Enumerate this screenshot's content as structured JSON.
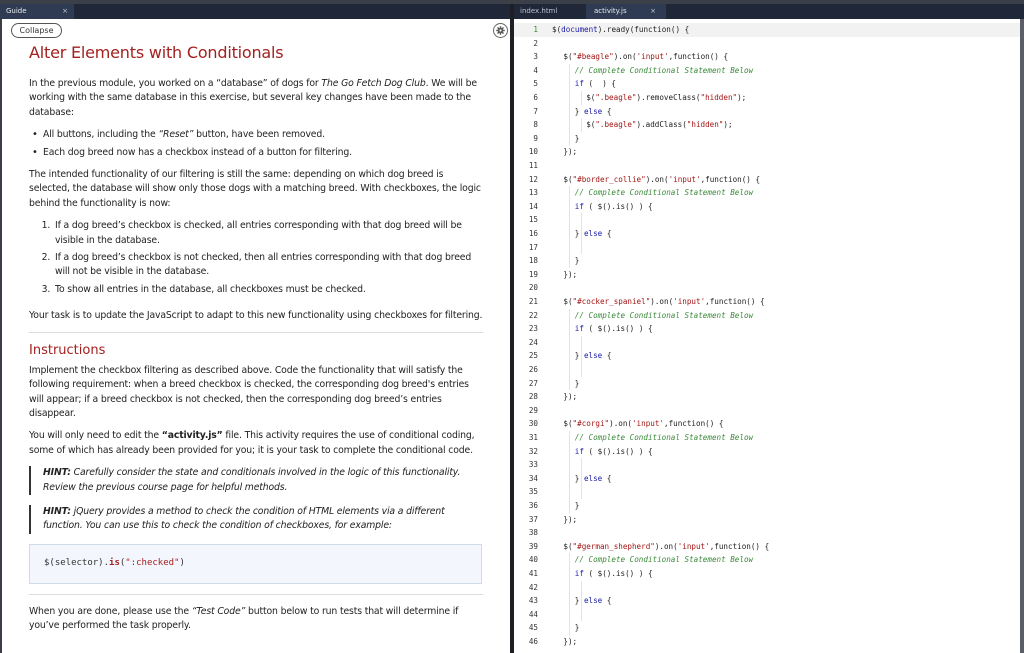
{
  "guide_panel": {
    "tab_label": "Guide",
    "tab_close": "×",
    "collapse_label": "Collapse",
    "title": "Alter Elements with Conditionals",
    "intro_pre": "In the previous module, you worked on a “database” of dogs for ",
    "intro_em": "The Go Fetch Dog Club",
    "intro_post": ". We will be working with the same database in this exercise, but several key changes have been made to the database:",
    "bullets": [
      {
        "pre": "All buttons, including the ",
        "em": "“Reset”",
        "post": " button, have been removed."
      },
      {
        "pre": "Each dog breed now has a checkbox instead of a button for filtering.",
        "em": "",
        "post": ""
      }
    ],
    "functionality_para": "The intended functionality of our filtering is still the same: depending on which dog breed is selected, the database will show only those dogs with a matching breed. With checkboxes, the logic behind the functionality is now:",
    "steps": [
      "If a dog breed’s checkbox is checked, all entries corresponding with that dog breed will be visible in the database.",
      "If a dog breed’s checkbox is not checked, then all entries corresponding with that dog breed will not be visible in the database.",
      "To show all entries in the database, all checkboxes must be checked."
    ],
    "task_para": "Your task is to update the JavaScript to adapt to this new functionality using checkboxes for filtering.",
    "instructions_heading": "Instructions",
    "instructions_para": "Implement the checkbox filtering as described above. Code the functionality that will satisfy the following requirement: when a breed checkbox is checked, the corresponding dog breed's entries will appear; if a breed checkbox is not checked, then the corresponding dog breed’s entries disappear.",
    "edit_pre": "You will only need to edit the ",
    "edit_bold": "“activity.js”",
    "edit_post": " file. This activity requires the use of conditional coding, some of which has already been provided for you; it is your task to complete the conditional code.",
    "hint1_label": "HINT:",
    "hint1_text": " Carefully consider the state and conditionals involved in the logic of this functionality. Review the previous course page for helpful methods.",
    "hint2_label": "HINT:",
    "hint2_text": " jQuery provides a method to check the condition of HTML elements via a different function. You can use this to check the condition of checkboxes, for example:",
    "code_example": {
      "prefix": "$(selector).",
      "method": "is",
      "open": "(",
      "arg": "\":checked\"",
      "close": ")"
    },
    "done_pre": "When you are done, please use the ",
    "done_em": "“Test Code”",
    "done_post": " button below to run tests that will determine if you’ve performed the task properly."
  },
  "editor_panel": {
    "tabs": [
      {
        "label": "index.html",
        "active": false
      },
      {
        "label": "activity.js",
        "active": true,
        "close": "×"
      }
    ],
    "active_line": 1,
    "lines": [
      {
        "n": "1",
        "indent": 0,
        "tokens": [
          [
            "",
            "$("
          ],
          [
            "blue",
            "document"
          ],
          [
            "",
            ").ready(function() {"
          ]
        ]
      },
      {
        "n": "2",
        "indent": 0,
        "tokens": []
      },
      {
        "n": "3",
        "indent": 1,
        "tokens": [
          [
            "",
            "$("
          ],
          [
            "str",
            "\"#beagle\""
          ],
          [
            "",
            ").on("
          ],
          [
            "str",
            "'input'"
          ],
          [
            "",
            ",function() {"
          ]
        ]
      },
      {
        "n": "4",
        "indent": 2,
        "tokens": [
          [
            "cmt",
            "// Complete Conditional Statement Below"
          ]
        ]
      },
      {
        "n": "5",
        "indent": 2,
        "tokens": [
          [
            "kw",
            "if"
          ],
          [
            "",
            " (  ) {"
          ]
        ]
      },
      {
        "n": "6",
        "indent": 3,
        "tokens": [
          [
            "",
            "$("
          ],
          [
            "str",
            "\".beagle\""
          ],
          [
            "",
            ").removeClass("
          ],
          [
            "str",
            "\"hidden\""
          ],
          [
            "",
            ");"
          ]
        ]
      },
      {
        "n": "7",
        "indent": 2,
        "tokens": [
          [
            "",
            "} "
          ],
          [
            "kw",
            "else"
          ],
          [
            "",
            " {"
          ]
        ]
      },
      {
        "n": "8",
        "indent": 3,
        "tokens": [
          [
            "",
            "$("
          ],
          [
            "str",
            "\".beagle\""
          ],
          [
            "",
            ").addClass("
          ],
          [
            "str",
            "\"hidden\""
          ],
          [
            "",
            ");"
          ]
        ]
      },
      {
        "n": "9",
        "indent": 2,
        "tokens": [
          [
            "",
            "}"
          ]
        ]
      },
      {
        "n": "10",
        "indent": 1,
        "tokens": [
          [
            "",
            "});"
          ]
        ]
      },
      {
        "n": "11",
        "indent": 0,
        "tokens": []
      },
      {
        "n": "12",
        "indent": 1,
        "tokens": [
          [
            "",
            "$("
          ],
          [
            "str",
            "\"#border_collie\""
          ],
          [
            "",
            ").on("
          ],
          [
            "str",
            "'input'"
          ],
          [
            "",
            ",function() {"
          ]
        ]
      },
      {
        "n": "13",
        "indent": 2,
        "tokens": [
          [
            "cmt",
            "// Complete Conditional Statement Below"
          ]
        ]
      },
      {
        "n": "14",
        "indent": 2,
        "tokens": [
          [
            "kw",
            "if"
          ],
          [
            "",
            " ( $().is() ) {"
          ]
        ]
      },
      {
        "n": "15",
        "indent": 0,
        "tokens": []
      },
      {
        "n": "16",
        "indent": 2,
        "tokens": [
          [
            "",
            "} "
          ],
          [
            "kw",
            "else"
          ],
          [
            "",
            " {"
          ]
        ]
      },
      {
        "n": "17",
        "indent": 0,
        "tokens": []
      },
      {
        "n": "18",
        "indent": 2,
        "tokens": [
          [
            "",
            "}"
          ]
        ]
      },
      {
        "n": "19",
        "indent": 1,
        "tokens": [
          [
            "",
            "});"
          ]
        ]
      },
      {
        "n": "20",
        "indent": 0,
        "tokens": []
      },
      {
        "n": "21",
        "indent": 1,
        "tokens": [
          [
            "",
            "$("
          ],
          [
            "str",
            "\"#cocker_spaniel\""
          ],
          [
            "",
            ").on("
          ],
          [
            "str",
            "'input'"
          ],
          [
            "",
            ",function() {"
          ]
        ]
      },
      {
        "n": "22",
        "indent": 2,
        "tokens": [
          [
            "cmt",
            "// Complete Conditional Statement Below"
          ]
        ]
      },
      {
        "n": "23",
        "indent": 2,
        "tokens": [
          [
            "kw",
            "if"
          ],
          [
            "",
            " ( $().is() ) {"
          ]
        ]
      },
      {
        "n": "24",
        "indent": 0,
        "tokens": []
      },
      {
        "n": "25",
        "indent": 2,
        "tokens": [
          [
            "",
            "} "
          ],
          [
            "kw",
            "else"
          ],
          [
            "",
            " {"
          ]
        ]
      },
      {
        "n": "26",
        "indent": 0,
        "tokens": []
      },
      {
        "n": "27",
        "indent": 2,
        "tokens": [
          [
            "",
            "}"
          ]
        ]
      },
      {
        "n": "28",
        "indent": 1,
        "tokens": [
          [
            "",
            "});"
          ]
        ]
      },
      {
        "n": "29",
        "indent": 0,
        "tokens": []
      },
      {
        "n": "30",
        "indent": 1,
        "tokens": [
          [
            "",
            "$("
          ],
          [
            "str",
            "\"#corgi\""
          ],
          [
            "",
            ").on("
          ],
          [
            "str",
            "'input'"
          ],
          [
            "",
            ",function() {"
          ]
        ]
      },
      {
        "n": "31",
        "indent": 2,
        "tokens": [
          [
            "cmt",
            "// Complete Conditional Statement Below"
          ]
        ]
      },
      {
        "n": "32",
        "indent": 2,
        "tokens": [
          [
            "kw",
            "if"
          ],
          [
            "",
            " ( $().is() ) {"
          ]
        ]
      },
      {
        "n": "33",
        "indent": 0,
        "tokens": []
      },
      {
        "n": "34",
        "indent": 2,
        "tokens": [
          [
            "",
            "} "
          ],
          [
            "kw",
            "else"
          ],
          [
            "",
            " {"
          ]
        ]
      },
      {
        "n": "35",
        "indent": 0,
        "tokens": []
      },
      {
        "n": "36",
        "indent": 2,
        "tokens": [
          [
            "",
            "}"
          ]
        ]
      },
      {
        "n": "37",
        "indent": 1,
        "tokens": [
          [
            "",
            "});"
          ]
        ]
      },
      {
        "n": "38",
        "indent": 0,
        "tokens": []
      },
      {
        "n": "39",
        "indent": 1,
        "tokens": [
          [
            "",
            "$("
          ],
          [
            "str",
            "\"#german_shepherd\""
          ],
          [
            "",
            ").on("
          ],
          [
            "str",
            "'input'"
          ],
          [
            "",
            ",function() {"
          ]
        ]
      },
      {
        "n": "40",
        "indent": 2,
        "tokens": [
          [
            "cmt",
            "// Complete Conditional Statement Below"
          ]
        ]
      },
      {
        "n": "41",
        "indent": 2,
        "tokens": [
          [
            "kw",
            "if"
          ],
          [
            "",
            " ( $().is() ) {"
          ]
        ]
      },
      {
        "n": "42",
        "indent": 0,
        "tokens": []
      },
      {
        "n": "43",
        "indent": 2,
        "tokens": [
          [
            "",
            "} "
          ],
          [
            "kw",
            "else"
          ],
          [
            "",
            " {"
          ]
        ]
      },
      {
        "n": "44",
        "indent": 0,
        "tokens": []
      },
      {
        "n": "45",
        "indent": 2,
        "tokens": [
          [
            "",
            "}"
          ]
        ]
      },
      {
        "n": "46",
        "indent": 1,
        "tokens": [
          [
            "",
            "});"
          ]
        ]
      }
    ]
  },
  "icons": {
    "settings": "gear-icon",
    "close": "close-icon"
  },
  "colors": {
    "heading": "#a3201f",
    "tabbar": "#1f2738",
    "active_tab": "#2f3b52",
    "comment": "#3a8a3a",
    "string": "#a31515",
    "keyword": "#1a1aa6"
  }
}
